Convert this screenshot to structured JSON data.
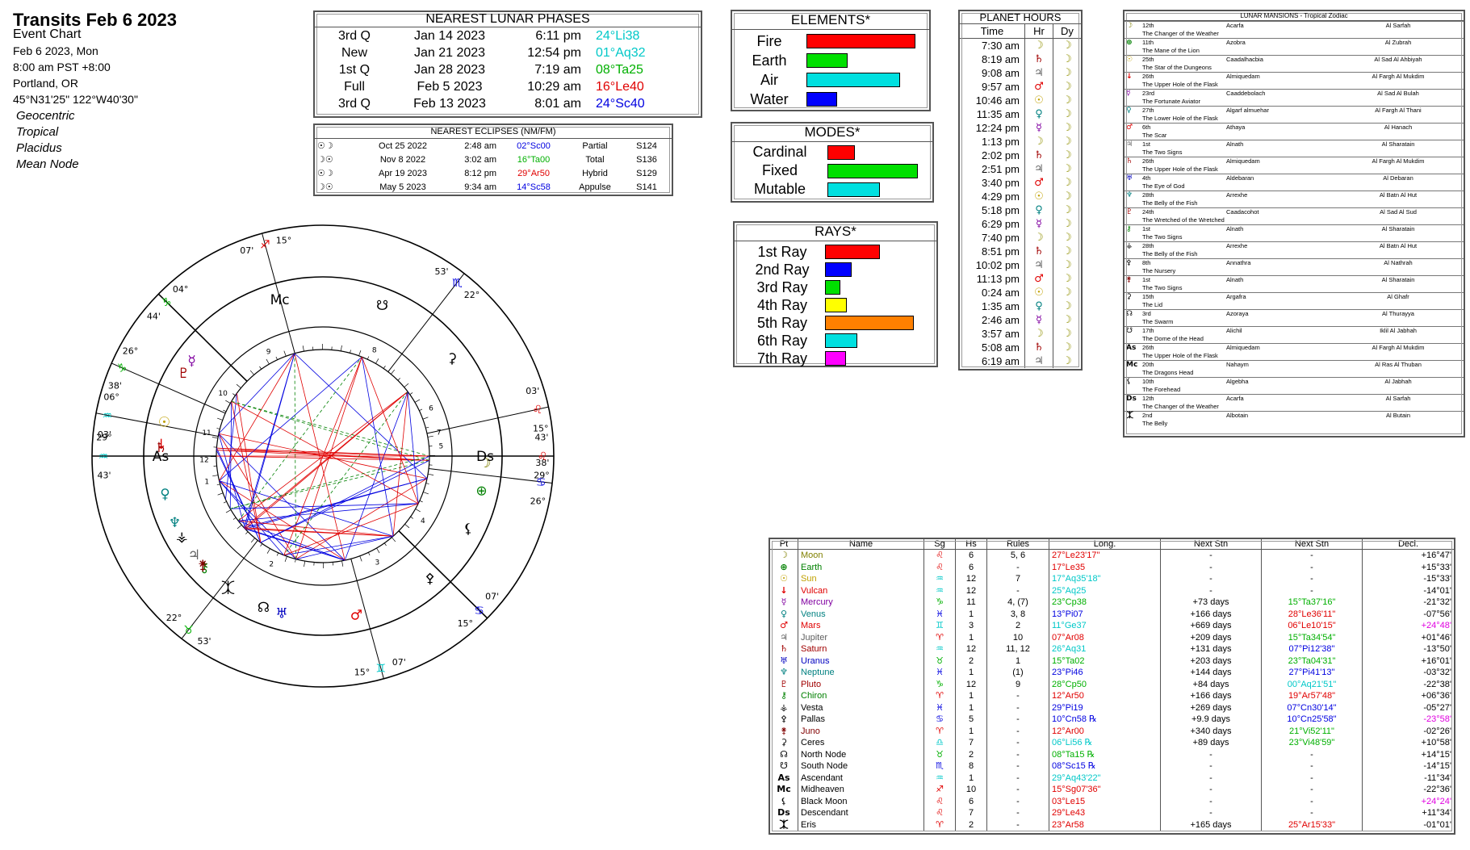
{
  "header": {
    "title": "Transits Feb 6 2023",
    "subtitle": "Event Chart",
    "lines": [
      "Feb 6 2023, Mon",
      "8:00 am  PST +8:00",
      "Portland, OR",
      "45°N31'25\"  122°W40'30\""
    ],
    "settings": [
      "Geocentric",
      "Tropical",
      "Placidus",
      "Mean Node"
    ]
  },
  "lunar_phases": {
    "title": "NEAREST LUNAR PHASES",
    "rows": [
      {
        "phase": "3rd Q",
        "date": "Jan 14 2023",
        "time": "6:11 pm",
        "pos": "24°Li38",
        "color": "#00c8c8"
      },
      {
        "phase": "New",
        "date": "Jan 21 2023",
        "time": "12:54 pm",
        "pos": "01°Aq32",
        "color": "#00c8c8"
      },
      {
        "phase": "1st Q",
        "date": "Jan 28 2023",
        "time": "7:19 am",
        "pos": "08°Ta25",
        "color": "#00b000"
      },
      {
        "phase": "Full",
        "date": "Feb 5 2023",
        "time": "10:29 am",
        "pos": "16°Le40",
        "color": "#e00000"
      },
      {
        "phase": "3rd Q",
        "date": "Feb 13 2023",
        "time": "8:01 am",
        "pos": "24°Sc40",
        "color": "#0000e0"
      }
    ]
  },
  "eclipses": {
    "title": "NEAREST ECLIPSES (NM/FM)",
    "rows": [
      {
        "icon": "☉☽",
        "date": "Oct 25 2022",
        "time": "2:48 am",
        "pos": "02°Sc00",
        "color": "#0000e0",
        "kind": "Partial",
        "saros": "S124"
      },
      {
        "icon": "☽☉",
        "date": "Nov 8 2022",
        "time": "3:02 am",
        "pos": "16°Ta00",
        "color": "#00b000",
        "kind": "Total",
        "saros": "S136"
      },
      {
        "icon": "☉☽",
        "date": "Apr 19 2023",
        "time": "8:12 pm",
        "pos": "29°Ar50",
        "color": "#e00000",
        "kind": "Hybrid",
        "saros": "S129"
      },
      {
        "icon": "☽☉",
        "date": "May 5 2023",
        "time": "9:34 am",
        "pos": "14°Sc58",
        "color": "#0000e0",
        "kind": "Appulse",
        "saros": "S141"
      }
    ]
  },
  "elements": {
    "title": "ELEMENTS*",
    "rows": [
      {
        "label": "Fire",
        "value": 0.95,
        "color": "#ff0000"
      },
      {
        "label": "Earth",
        "value": 0.36,
        "color": "#00e000"
      },
      {
        "label": "Air",
        "value": 0.82,
        "color": "#00e0e0"
      },
      {
        "label": "Water",
        "value": 0.27,
        "color": "#0000ff"
      }
    ]
  },
  "modes": {
    "title": "MODES*",
    "rows": [
      {
        "label": "Cardinal",
        "value": 0.28,
        "color": "#ff0000"
      },
      {
        "label": "Fixed",
        "value": 0.92,
        "color": "#00e000"
      },
      {
        "label": "Mutable",
        "value": 0.53,
        "color": "#00e0e0"
      }
    ]
  },
  "rays": {
    "title": "RAYS*",
    "rows": [
      {
        "label": "1st Ray",
        "value": 0.53,
        "color": "#ff0000"
      },
      {
        "label": "2nd Ray",
        "value": 0.26,
        "color": "#0000ff"
      },
      {
        "label": "3rd Ray",
        "value": 0.15,
        "color": "#00e000"
      },
      {
        "label": "4th Ray",
        "value": 0.21,
        "color": "#ffff00"
      },
      {
        "label": "5th Ray",
        "value": 0.86,
        "color": "#ff8000"
      },
      {
        "label": "6th Ray",
        "value": 0.31,
        "color": "#00e0e0"
      },
      {
        "label": "7th Ray",
        "value": 0.2,
        "color": "#ff00ff"
      }
    ]
  },
  "planet_hours": {
    "title": "PLANET HOURS",
    "headers": [
      "Time",
      "Hr",
      "Dy"
    ],
    "rows": [
      [
        "7:30 am",
        "☽",
        "☽"
      ],
      [
        "8:19 am",
        "♄",
        "☽"
      ],
      [
        "9:08 am",
        "♃",
        "☽"
      ],
      [
        "9:57 am",
        "♂",
        "☽"
      ],
      [
        "10:46 am",
        "☉",
        "☽"
      ],
      [
        "11:35 am",
        "♀",
        "☽"
      ],
      [
        "12:24 pm",
        "☿",
        "☽"
      ],
      [
        "1:13 pm",
        "☽",
        "☽"
      ],
      [
        "2:02 pm",
        "♄",
        "☽"
      ],
      [
        "2:51 pm",
        "♃",
        "☽"
      ],
      [
        "3:40 pm",
        "♂",
        "☽"
      ],
      [
        "4:29 pm",
        "☉",
        "☽"
      ],
      [
        "5:18 pm",
        "♀",
        "☽"
      ],
      [
        "6:29 pm",
        "☿",
        "☽"
      ],
      [
        "7:40 pm",
        "☽",
        "☽"
      ],
      [
        "8:51 pm",
        "♄",
        "☽"
      ],
      [
        "10:02 pm",
        "♃",
        "☽"
      ],
      [
        "11:13 pm",
        "♂",
        "☽"
      ],
      [
        "0:24 am",
        "☉",
        "☽"
      ],
      [
        "1:35 am",
        "♀",
        "☽"
      ],
      [
        "2:46 am",
        "☿",
        "☽"
      ],
      [
        "3:57 am",
        "☽",
        "☽"
      ],
      [
        "5:08 am",
        "♄",
        "☽"
      ],
      [
        "6:19 am",
        "♃",
        "☽"
      ]
    ]
  },
  "lunar_mansions": {
    "title": "LUNAR MANSIONS - Tropical Zodiac",
    "rows": [
      {
        "g": "☽",
        "gc": "#808000",
        "n": "12th",
        "a": "Acarfa",
        "b": "Al Sarfah",
        "d": "The Changer of the Weather"
      },
      {
        "g": "⊕",
        "gc": "#008000",
        "n": "11th",
        "a": "Azobra",
        "b": "Al Zubrah",
        "d": "The Mane of the Lion"
      },
      {
        "g": "☉",
        "gc": "#c0a000",
        "n": "25th",
        "a": "Caadalhacbia",
        "b": "Al Sad Al Ahbiyah",
        "d": "The Star of the Dungeons"
      },
      {
        "g": "↓",
        "gc": "#e00000",
        "n": "26th",
        "a": "Almiquedam",
        "b": "Al Fargh Al Mukdim",
        "d": "The Upper Hole of the Flask"
      },
      {
        "g": "☿",
        "gc": "#8000a0",
        "n": "23rd",
        "a": "Caaddebolach",
        "b": "Al Sad Al Bulah",
        "d": "The Fortunate Aviator"
      },
      {
        "g": "♀",
        "gc": "#008080",
        "n": "27th",
        "a": "Algarf almuehar",
        "b": "Al Fargh Al Thani",
        "d": "The Lower Hole of the Flask"
      },
      {
        "g": "♂",
        "gc": "#e00000",
        "n": "6th",
        "a": "Athaya",
        "b": "Al Hanach",
        "d": "The Scar"
      },
      {
        "g": "♃",
        "gc": "#606060",
        "n": "1st",
        "a": "Alnath",
        "b": "Al Sharatain",
        "d": "The Two Signs"
      },
      {
        "g": "♄",
        "gc": "#a00000",
        "n": "26th",
        "a": "Almiquedam",
        "b": "Al Fargh Al Mukdim",
        "d": "The Upper Hole of the Flask"
      },
      {
        "g": "♅",
        "gc": "#0000c0",
        "n": "4th",
        "a": "Aldebaran",
        "b": "Al Debaran",
        "d": "The Eye of God"
      },
      {
        "g": "♆",
        "gc": "#008080",
        "n": "28th",
        "a": "Arrexhe",
        "b": "Al Batn Al Hut",
        "d": "The Belly of the Fish"
      },
      {
        "g": "♇",
        "gc": "#a00000",
        "n": "24th",
        "a": "Caadacohot",
        "b": "Al Sad Al Sud",
        "d": "The Wretched of the Wretched"
      },
      {
        "g": "⚷",
        "gc": "#008000",
        "n": "1st",
        "a": "Alnath",
        "b": "Al Sharatain",
        "d": "The Two Signs"
      },
      {
        "g": "⚶",
        "gc": "#000000",
        "n": "28th",
        "a": "Arrexhe",
        "b": "Al Batn Al Hut",
        "d": "The Belly of the Fish"
      },
      {
        "g": "⚴",
        "gc": "#000000",
        "n": "8th",
        "a": "Annathra",
        "b": "Al Nathrah",
        "d": "The Nursery"
      },
      {
        "g": "⚵",
        "gc": "#800000",
        "n": "1st",
        "a": "Alnath",
        "b": "Al Sharatain",
        "d": "The Two Signs"
      },
      {
        "g": "⚳",
        "gc": "#000000",
        "n": "15th",
        "a": "Argafra",
        "b": "Al Ghafr",
        "d": "The Lid"
      },
      {
        "g": "☊",
        "gc": "#000000",
        "n": "3rd",
        "a": "Azoraya",
        "b": "Al Thurayya",
        "d": "The Swarm"
      },
      {
        "g": "☋",
        "gc": "#000000",
        "n": "17th",
        "a": "Alichil",
        "b": "Iklil Al Jabhah",
        "d": "The Dome of the Head"
      },
      {
        "g": "As",
        "gc": "#000000",
        "n": "26th",
        "a": "Almiquedam",
        "b": "Al Fargh Al Mukdim",
        "d": "The Upper Hole of the Flask"
      },
      {
        "g": "Mc",
        "gc": "#000000",
        "n": "20th",
        "a": "Nahaym",
        "b": "Al Ras Al Thuban",
        "d": "The Dragons Head"
      },
      {
        "g": "⚸",
        "gc": "#000000",
        "n": "10th",
        "a": "Algebha",
        "b": "Al Jabhah",
        "d": "The Forehead"
      },
      {
        "g": "Ds",
        "gc": "#000000",
        "n": "12th",
        "a": "Acarfa",
        "b": "Al Sarfah",
        "d": "The Changer of the Weather"
      },
      {
        "g": "⯰",
        "gc": "#000000",
        "n": "2nd",
        "a": "Albotain",
        "b": "Al Butain",
        "d": "The Belly"
      }
    ]
  },
  "planet_table": {
    "headers": [
      "Pt",
      "Name",
      "Sg",
      "Hs",
      "Rules",
      "Long.",
      "Next Stn",
      "Next Stn",
      "Decl."
    ],
    "rows": [
      {
        "g": "☽",
        "name": "Moon",
        "nc": "#808000",
        "sg": "♌",
        "sc": "#e00000",
        "hs": "6",
        "rules": "5, 6",
        "long": "27°Le23'17\"",
        "lc": "#e00000",
        "ns1": "-",
        "ns2": "-",
        "n2c": "#000",
        "decl": "+16°47'",
        "dc": "#000"
      },
      {
        "g": "⊕",
        "name": "Earth",
        "nc": "#008000",
        "sg": "♌",
        "sc": "#e00000",
        "hs": "6",
        "rules": "-",
        "long": "17°Le35",
        "lc": "#e00000",
        "ns1": "-",
        "ns2": "-",
        "n2c": "#000",
        "decl": "+15°33'",
        "dc": "#000"
      },
      {
        "g": "☉",
        "name": "Sun",
        "nc": "#c0a000",
        "sg": "♒",
        "sc": "#00c8c8",
        "hs": "12",
        "rules": "7",
        "long": "17°Aq35'18\"",
        "lc": "#00c8c8",
        "ns1": "-",
        "ns2": "-",
        "n2c": "#000",
        "decl": "-15°33'",
        "dc": "#000"
      },
      {
        "g": "↓",
        "name": "Vulcan",
        "nc": "#e00000",
        "sg": "♒",
        "sc": "#00c8c8",
        "hs": "12",
        "rules": "-",
        "long": "25°Aq25",
        "lc": "#00c8c8",
        "ns1": "-",
        "ns2": "-",
        "n2c": "#000",
        "decl": "-14°01'",
        "dc": "#000"
      },
      {
        "g": "☿",
        "name": "Mercury",
        "nc": "#8000a0",
        "sg": "♑",
        "sc": "#00b000",
        "hs": "11",
        "rules": "4, (7)",
        "long": "23°Cp38",
        "lc": "#00b000",
        "ns1": "+73 days",
        "ns2": "15°Ta37'16\"",
        "n2c": "#00b000",
        "decl": "-21°32'",
        "dc": "#000"
      },
      {
        "g": "♀",
        "name": "Venus",
        "nc": "#008080",
        "sg": "♓",
        "sc": "#0000e0",
        "hs": "1",
        "rules": "3, 8",
        "long": "13°Pi07",
        "lc": "#0000e0",
        "ns1": "+166 days",
        "ns2": "28°Le36'11\"",
        "n2c": "#e00000",
        "decl": "-07°56'",
        "dc": "#000"
      },
      {
        "g": "♂",
        "name": "Mars",
        "nc": "#e00000",
        "sg": "♊",
        "sc": "#00c8c8",
        "hs": "3",
        "rules": "2",
        "long": "11°Ge37",
        "lc": "#00c8c8",
        "ns1": "+669 days",
        "ns2": "06°Le10'15\"",
        "n2c": "#e00000",
        "decl": "+24°48'",
        "dc": "#e000e0"
      },
      {
        "g": "♃",
        "name": "Jupiter",
        "nc": "#606060",
        "sg": "♈",
        "sc": "#e00000",
        "hs": "1",
        "rules": "10",
        "long": "07°Ar08",
        "lc": "#e00000",
        "ns1": "+209 days",
        "ns2": "15°Ta34'54\"",
        "n2c": "#00b000",
        "decl": "+01°46'",
        "dc": "#000"
      },
      {
        "g": "♄",
        "name": "Saturn",
        "nc": "#a00000",
        "sg": "♒",
        "sc": "#00c8c8",
        "hs": "12",
        "rules": "11, 12",
        "long": "26°Aq31",
        "lc": "#00c8c8",
        "ns1": "+131 days",
        "ns2": "07°Pi12'38\"",
        "n2c": "#0000e0",
        "decl": "-13°50'",
        "dc": "#000"
      },
      {
        "g": "♅",
        "name": "Uranus",
        "nc": "#0000c0",
        "sg": "♉",
        "sc": "#00b000",
        "hs": "2",
        "rules": "1",
        "long": "15°Ta02",
        "lc": "#00b000",
        "ns1": "+203 days",
        "ns2": "23°Ta04'31\"",
        "n2c": "#00b000",
        "decl": "+16°01'",
        "dc": "#000"
      },
      {
        "g": "♆",
        "name": "Neptune",
        "nc": "#008080",
        "sg": "♓",
        "sc": "#0000e0",
        "hs": "1",
        "rules": "(1)",
        "long": "23°Pi46",
        "lc": "#0000e0",
        "ns1": "+144 days",
        "ns2": "27°Pi41'13\"",
        "n2c": "#0000e0",
        "decl": "-03°32'",
        "dc": "#000"
      },
      {
        "g": "♇",
        "name": "Pluto",
        "nc": "#a00000",
        "sg": "♑",
        "sc": "#00b000",
        "hs": "12",
        "rules": "9",
        "long": "28°Cp50",
        "lc": "#00b000",
        "ns1": "+84 days",
        "ns2": "00°Aq21'51\"",
        "n2c": "#00c8c8",
        "decl": "-22°38'",
        "dc": "#000"
      },
      {
        "g": "⚷",
        "name": "Chiron",
        "nc": "#008000",
        "sg": "♈",
        "sc": "#e00000",
        "hs": "1",
        "rules": "-",
        "long": "12°Ar50",
        "lc": "#e00000",
        "ns1": "+166 days",
        "ns2": "19°Ar57'48\"",
        "n2c": "#e00000",
        "decl": "+06°36'",
        "dc": "#000"
      },
      {
        "g": "⚶",
        "name": "Vesta",
        "nc": "#000000",
        "sg": "♓",
        "sc": "#0000e0",
        "hs": "1",
        "rules": "-",
        "long": "29°Pi19",
        "lc": "#0000e0",
        "ns1": "+269 days",
        "ns2": "07°Cn30'14\"",
        "n2c": "#0000e0",
        "decl": "-05°27'",
        "dc": "#000"
      },
      {
        "g": "⚴",
        "name": "Pallas",
        "nc": "#000000",
        "sg": "♋",
        "sc": "#0000e0",
        "hs": "5",
        "rules": "-",
        "long": "10°Cn58 ℞",
        "lc": "#0000e0",
        "ns1": "+9.9 days",
        "ns2": "10°Cn25'58\"",
        "n2c": "#0000e0",
        "decl": "-23°58'",
        "dc": "#e000e0"
      },
      {
        "g": "⚵",
        "name": "Juno",
        "nc": "#800000",
        "sg": "♈",
        "sc": "#e00000",
        "hs": "1",
        "rules": "-",
        "long": "12°Ar00",
        "lc": "#e00000",
        "ns1": "+340 days",
        "ns2": "21°Vi52'11\"",
        "n2c": "#00b000",
        "decl": "-02°26'",
        "dc": "#000"
      },
      {
        "g": "⚳",
        "name": "Ceres",
        "nc": "#000000",
        "sg": "♎",
        "sc": "#00c8c8",
        "hs": "7",
        "rules": "-",
        "long": "06°Li56 ℞",
        "lc": "#00c8c8",
        "ns1": "+89 days",
        "ns2": "23°Vi48'59\"",
        "n2c": "#00b000",
        "decl": "+10°58'",
        "dc": "#000"
      },
      {
        "g": "☊",
        "name": "North Node",
        "nc": "#000000",
        "sg": "♉",
        "sc": "#00b000",
        "hs": "2",
        "rules": "-",
        "long": "08°Ta15 ℞",
        "lc": "#00b000",
        "ns1": "-",
        "ns2": "-",
        "n2c": "#000",
        "decl": "+14°15'",
        "dc": "#000"
      },
      {
        "g": "☋",
        "name": "South Node",
        "nc": "#000000",
        "sg": "♏",
        "sc": "#0000e0",
        "hs": "8",
        "rules": "-",
        "long": "08°Sc15 ℞",
        "lc": "#0000e0",
        "ns1": "-",
        "ns2": "-",
        "n2c": "#000",
        "decl": "-14°15'",
        "dc": "#000"
      },
      {
        "g": "As",
        "name": "Ascendant",
        "nc": "#000000",
        "sg": "♒",
        "sc": "#00c8c8",
        "hs": "1",
        "rules": "-",
        "long": "29°Aq43'22\"",
        "lc": "#00c8c8",
        "ns1": "-",
        "ns2": "-",
        "n2c": "#000",
        "decl": "-11°34'",
        "dc": "#000"
      },
      {
        "g": "Mc",
        "name": "Midheaven",
        "nc": "#000000",
        "sg": "♐",
        "sc": "#e00000",
        "hs": "10",
        "rules": "-",
        "long": "15°Sg07'36\"",
        "lc": "#e00000",
        "ns1": "-",
        "ns2": "-",
        "n2c": "#000",
        "decl": "-22°36'",
        "dc": "#000"
      },
      {
        "g": "⚸",
        "name": "Black Moon",
        "nc": "#000000",
        "sg": "♌",
        "sc": "#e00000",
        "hs": "6",
        "rules": "-",
        "long": "03°Le15",
        "lc": "#e00000",
        "ns1": "-",
        "ns2": "-",
        "n2c": "#000",
        "decl": "+24°24'",
        "dc": "#e000e0"
      },
      {
        "g": "Ds",
        "name": "Descendant",
        "nc": "#000000",
        "sg": "♌",
        "sc": "#e00000",
        "hs": "7",
        "rules": "-",
        "long": "29°Le43",
        "lc": "#e00000",
        "ns1": "-",
        "ns2": "-",
        "n2c": "#000",
        "decl": "+11°34'",
        "dc": "#000"
      },
      {
        "g": "⯰",
        "name": "Eris",
        "nc": "#000000",
        "sg": "♈",
        "sc": "#e00000",
        "hs": "2",
        "rules": "-",
        "long": "23°Ar58",
        "lc": "#e00000",
        "ns1": "+165 days",
        "ns2": "25°Ar15'33\"",
        "n2c": "#e00000",
        "decl": "-01°01'",
        "dc": "#000"
      }
    ]
  },
  "wheel": {
    "ascendant_deg": 329.72,
    "cusps": [
      {
        "num": "1",
        "lon": 329.72,
        "deg": "29°",
        "sign": "♒",
        "min": "43'",
        "color": "#00c8c8"
      },
      {
        "num": "2",
        "lon": 22.0,
        "deg": "22°",
        "sign": "♉",
        "min": "53'",
        "color": "#00b000"
      },
      {
        "num": "3",
        "lon": 75.0,
        "deg": "15°",
        "sign": "♊",
        "min": "07'",
        "color": "#00c8c8"
      },
      {
        "num": "4",
        "lon": 105.13,
        "deg": "15°",
        "sign": "♋",
        "min": "07'",
        "color": "#0000e0"
      },
      {
        "num": "5",
        "lon": 143.0,
        "deg": "26°",
        "sign": "♋",
        "min": "38'",
        "color": "#0000e0"
      },
      {
        "num": "6",
        "lon": 162.0,
        "deg": "15°",
        "sign": "♌",
        "min": "03'",
        "color": "#e00000"
      },
      {
        "num": "7",
        "lon": 149.72,
        "deg": "29°",
        "sign": "♌",
        "min": "43'",
        "color": "#e00000"
      },
      {
        "num": "8",
        "lon": 202.0,
        "deg": "22°",
        "sign": "♏",
        "min": "53'",
        "color": "#0000e0"
      },
      {
        "num": "9",
        "lon": 255.0,
        "deg": "15°",
        "sign": "♐",
        "min": "07'",
        "color": "#e00000"
      },
      {
        "num": "10",
        "lon": 285.13,
        "deg": "04°",
        "sign": "♑",
        "min": "44'",
        "color": "#00b000"
      },
      {
        "num": "11",
        "lon": 306.0,
        "deg": "26°",
        "sign": "♑",
        "min": "38'",
        "color": "#00b000"
      },
      {
        "num": "12",
        "lon": 319.0,
        "deg": "06°",
        "sign": "♒",
        "min": "03'",
        "color": "#00c8c8"
      }
    ],
    "colors": {
      "fire": "#e00000",
      "earth": "#00b000",
      "air": "#00c8c8",
      "water": "#0000e0"
    }
  }
}
